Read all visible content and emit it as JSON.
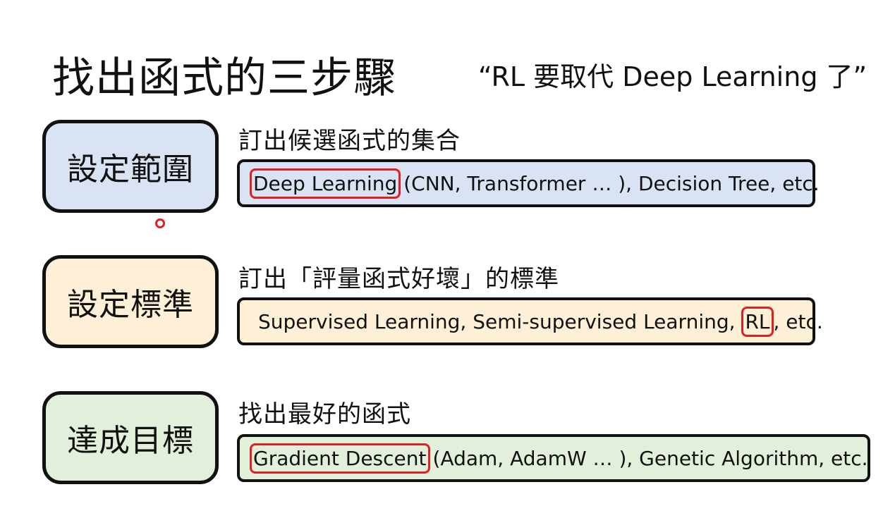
{
  "title": "找出函式的三步驟",
  "quote": "“RL 要取代 Deep Learning 了”",
  "steps": [
    {
      "label": "設定範圍",
      "description": "訂出候選函式的集合",
      "example_highlight": "Deep Learning",
      "example_rest": " (CNN, Transformer … ), Decision Tree, etc.",
      "color": "#dae3f3"
    },
    {
      "label": "設定標準",
      "description": "訂出「評量函式好壞」的標準",
      "example_prefix": "Supervised Learning, Semi-supervised Learning, ",
      "example_highlight": "RL",
      "example_rest": ", etc.",
      "color": "#fdf0d6"
    },
    {
      "label": "達成目標",
      "description": "找出最好的函式",
      "example_highlight": "Gradient Descent",
      "example_rest": " (Adam, AdamW … ), Genetic Algorithm, etc.",
      "color": "#e2efda"
    }
  ],
  "highlight_color": "#e02020"
}
